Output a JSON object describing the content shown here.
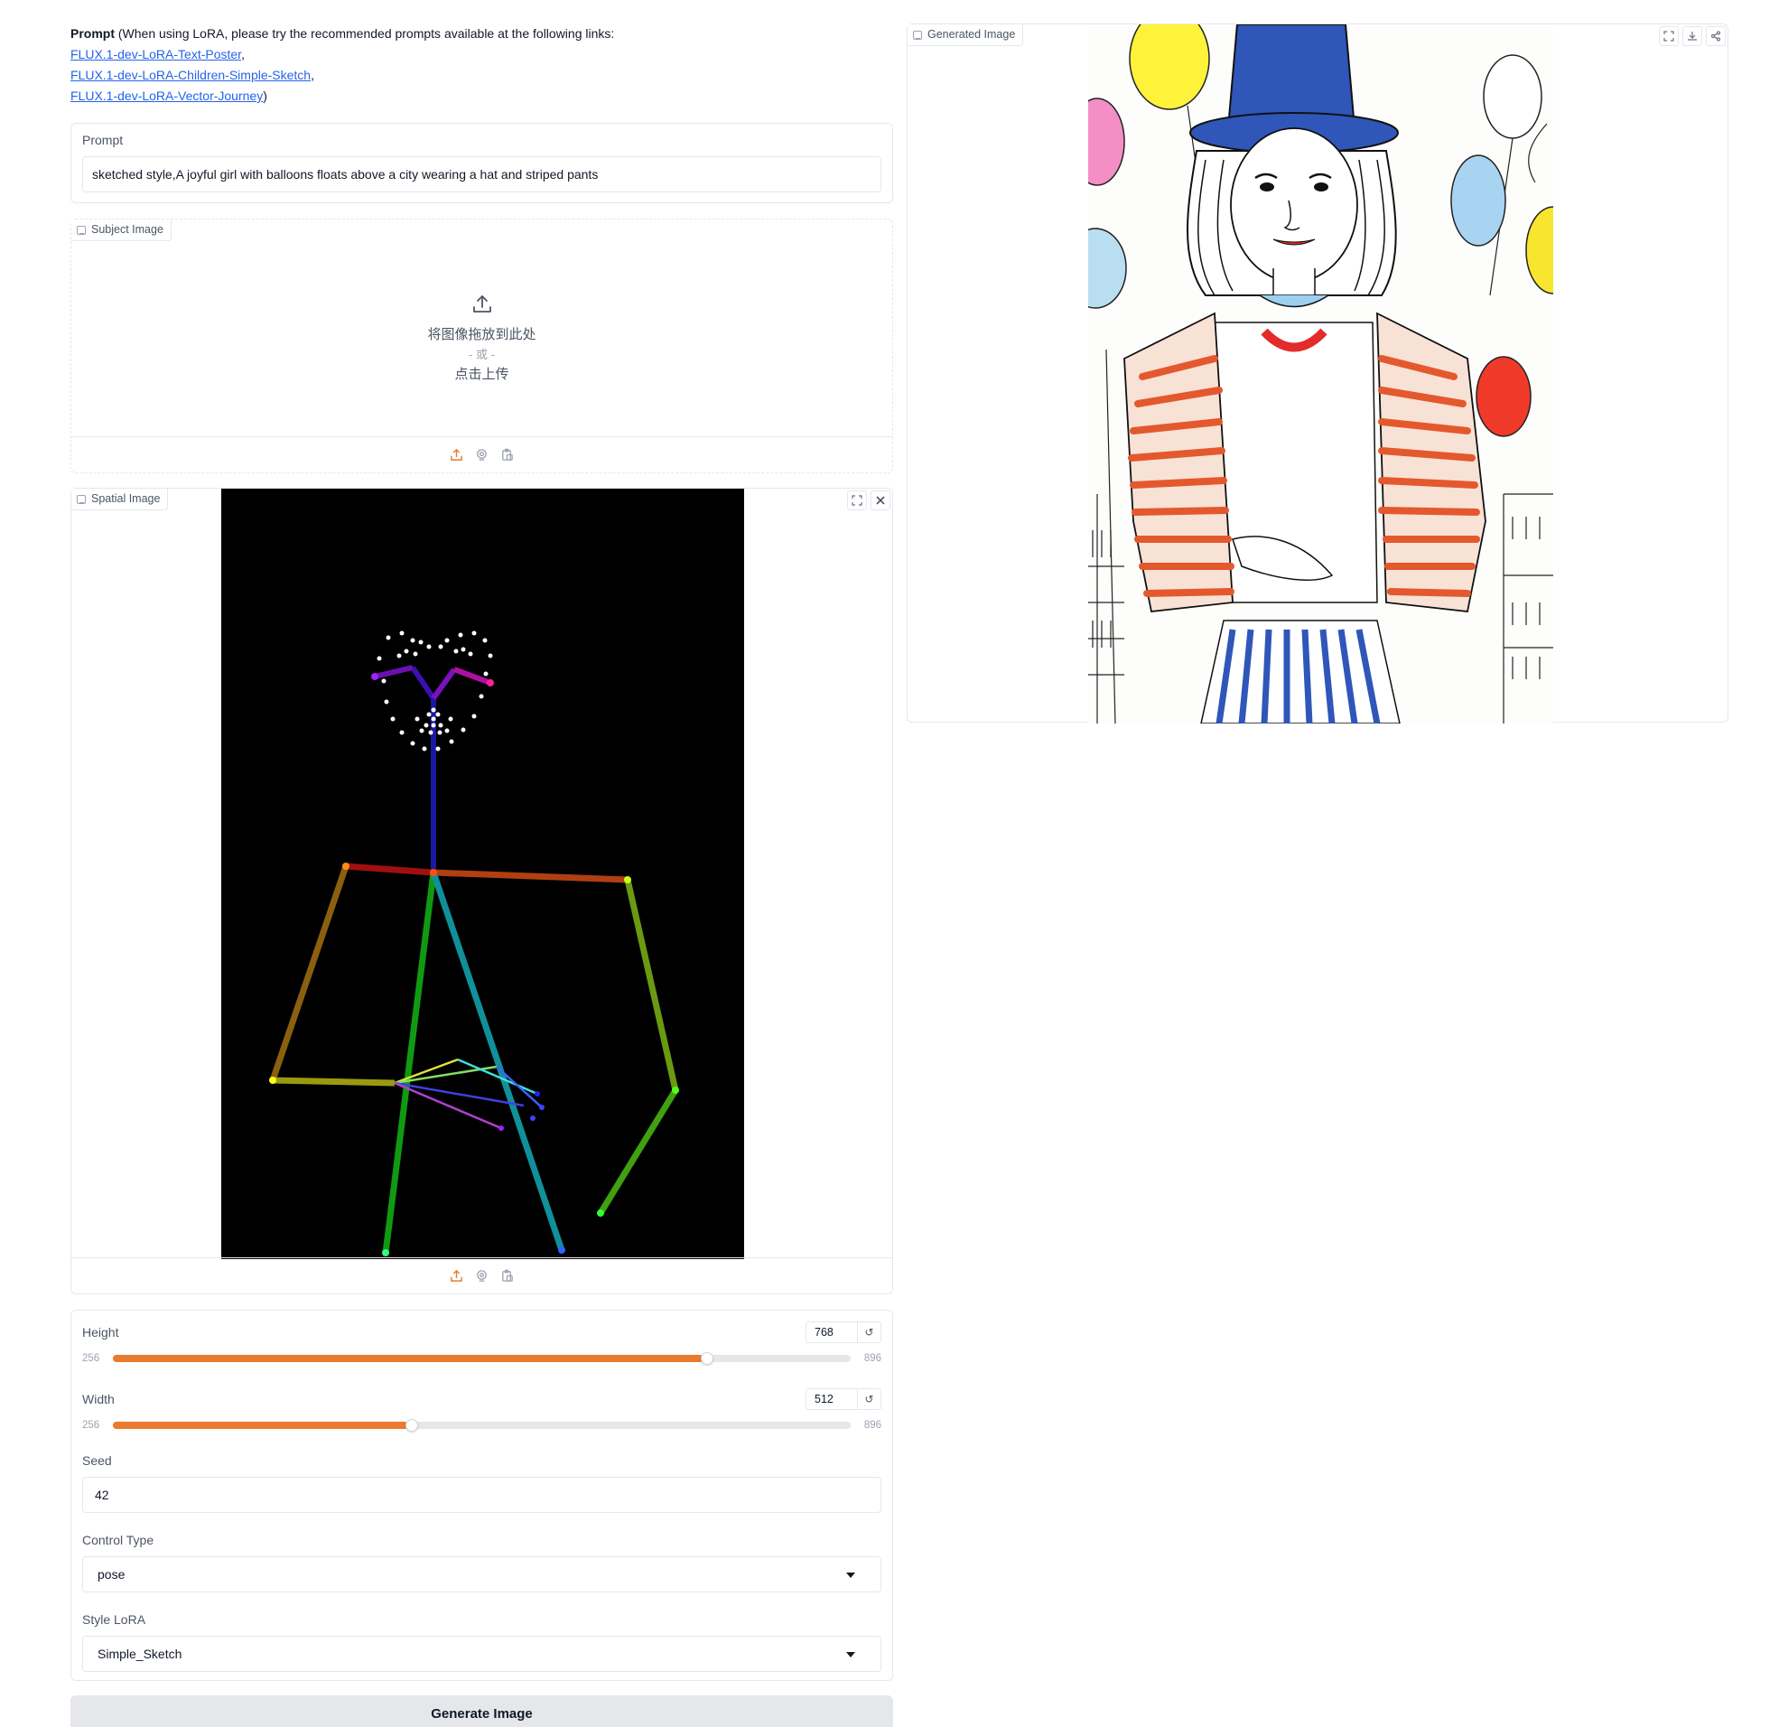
{
  "intro": {
    "prompt_bold": "Prompt",
    "prompt_note": " (When using LoRA, please try the recommended prompts available at the following links:",
    "links": [
      {
        "text": "FLUX.1-dev-LoRA-Text-Poster",
        "suffix": ","
      },
      {
        "text": "FLUX.1-dev-LoRA-Children-Simple-Sketch",
        "suffix": ","
      },
      {
        "text": "FLUX.1-dev-LoRA-Vector-Journey",
        "suffix": ")"
      }
    ]
  },
  "prompt": {
    "label": "Prompt",
    "value": "sketched style,A joyful girl with balloons floats above a city wearing a hat and striped pants"
  },
  "subject_image": {
    "label": "Subject Image",
    "drop_text": "将图像拖放到此处",
    "or_text": "- 或 -",
    "click_text": "点击上传"
  },
  "spatial_image": {
    "label": "Spatial Image"
  },
  "height": {
    "label": "Height",
    "value": "768",
    "min": "256",
    "max": "896",
    "fraction": 0.8
  },
  "width": {
    "label": "Width",
    "value": "512",
    "min": "256",
    "max": "896",
    "fraction": 0.4
  },
  "seed": {
    "label": "Seed",
    "value": "42"
  },
  "control_type": {
    "label": "Control Type",
    "value": "pose"
  },
  "style_lora": {
    "label": "Style LoRA",
    "value": "Simple_Sketch"
  },
  "generate_button": "Generate Image",
  "generated_image": {
    "label": "Generated Image"
  },
  "colors": {
    "accent": "#ea7a2f",
    "link": "#2563eb"
  }
}
